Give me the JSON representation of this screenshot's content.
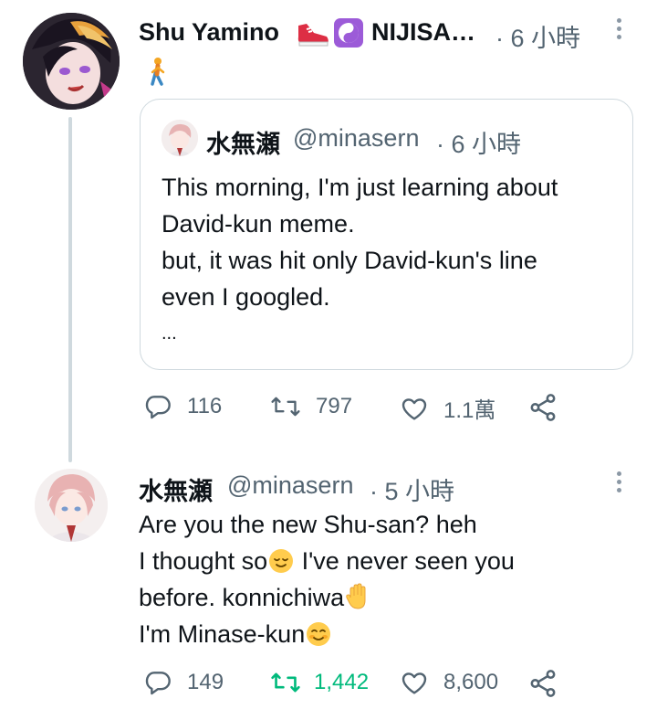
{
  "tweet1": {
    "display_name": "Shu Yamino",
    "name_suffix": "NIJISA…",
    "time": "· 6 小時",
    "emoji_text": "🚶",
    "icons": [
      "sneaker-emoji",
      "yin-yang-emoji",
      "person-walking-emoji"
    ],
    "quote": {
      "display_name": "水無瀬",
      "handle": "@minasern",
      "time": "· 6 小時",
      "lines": [
        "This morning, I'm just learning about",
        "David-kun meme.",
        "but, it was hit only David-kun's line",
        "even I googled.",
        "..."
      ]
    },
    "actions": {
      "replies": "116",
      "retweets": "797",
      "likes": "1.1萬"
    }
  },
  "tweet2": {
    "display_name": "水無瀬",
    "handle": "@minasern",
    "time": "· 5 小時",
    "lines": {
      "l1": "Are you the new Shu-san? heh",
      "l2a": "I thought so",
      "l2b": " I've never seen you",
      "l3": "before. konnichiwa",
      "l4": "I'm Minase-kun"
    },
    "actions": {
      "replies": "149",
      "retweets": "1,442",
      "likes": "8,600"
    }
  },
  "colors": {
    "text": "#0f1419",
    "muted": "#536471",
    "retweet_active": "#00ba7c",
    "border": "#cfd9de"
  }
}
